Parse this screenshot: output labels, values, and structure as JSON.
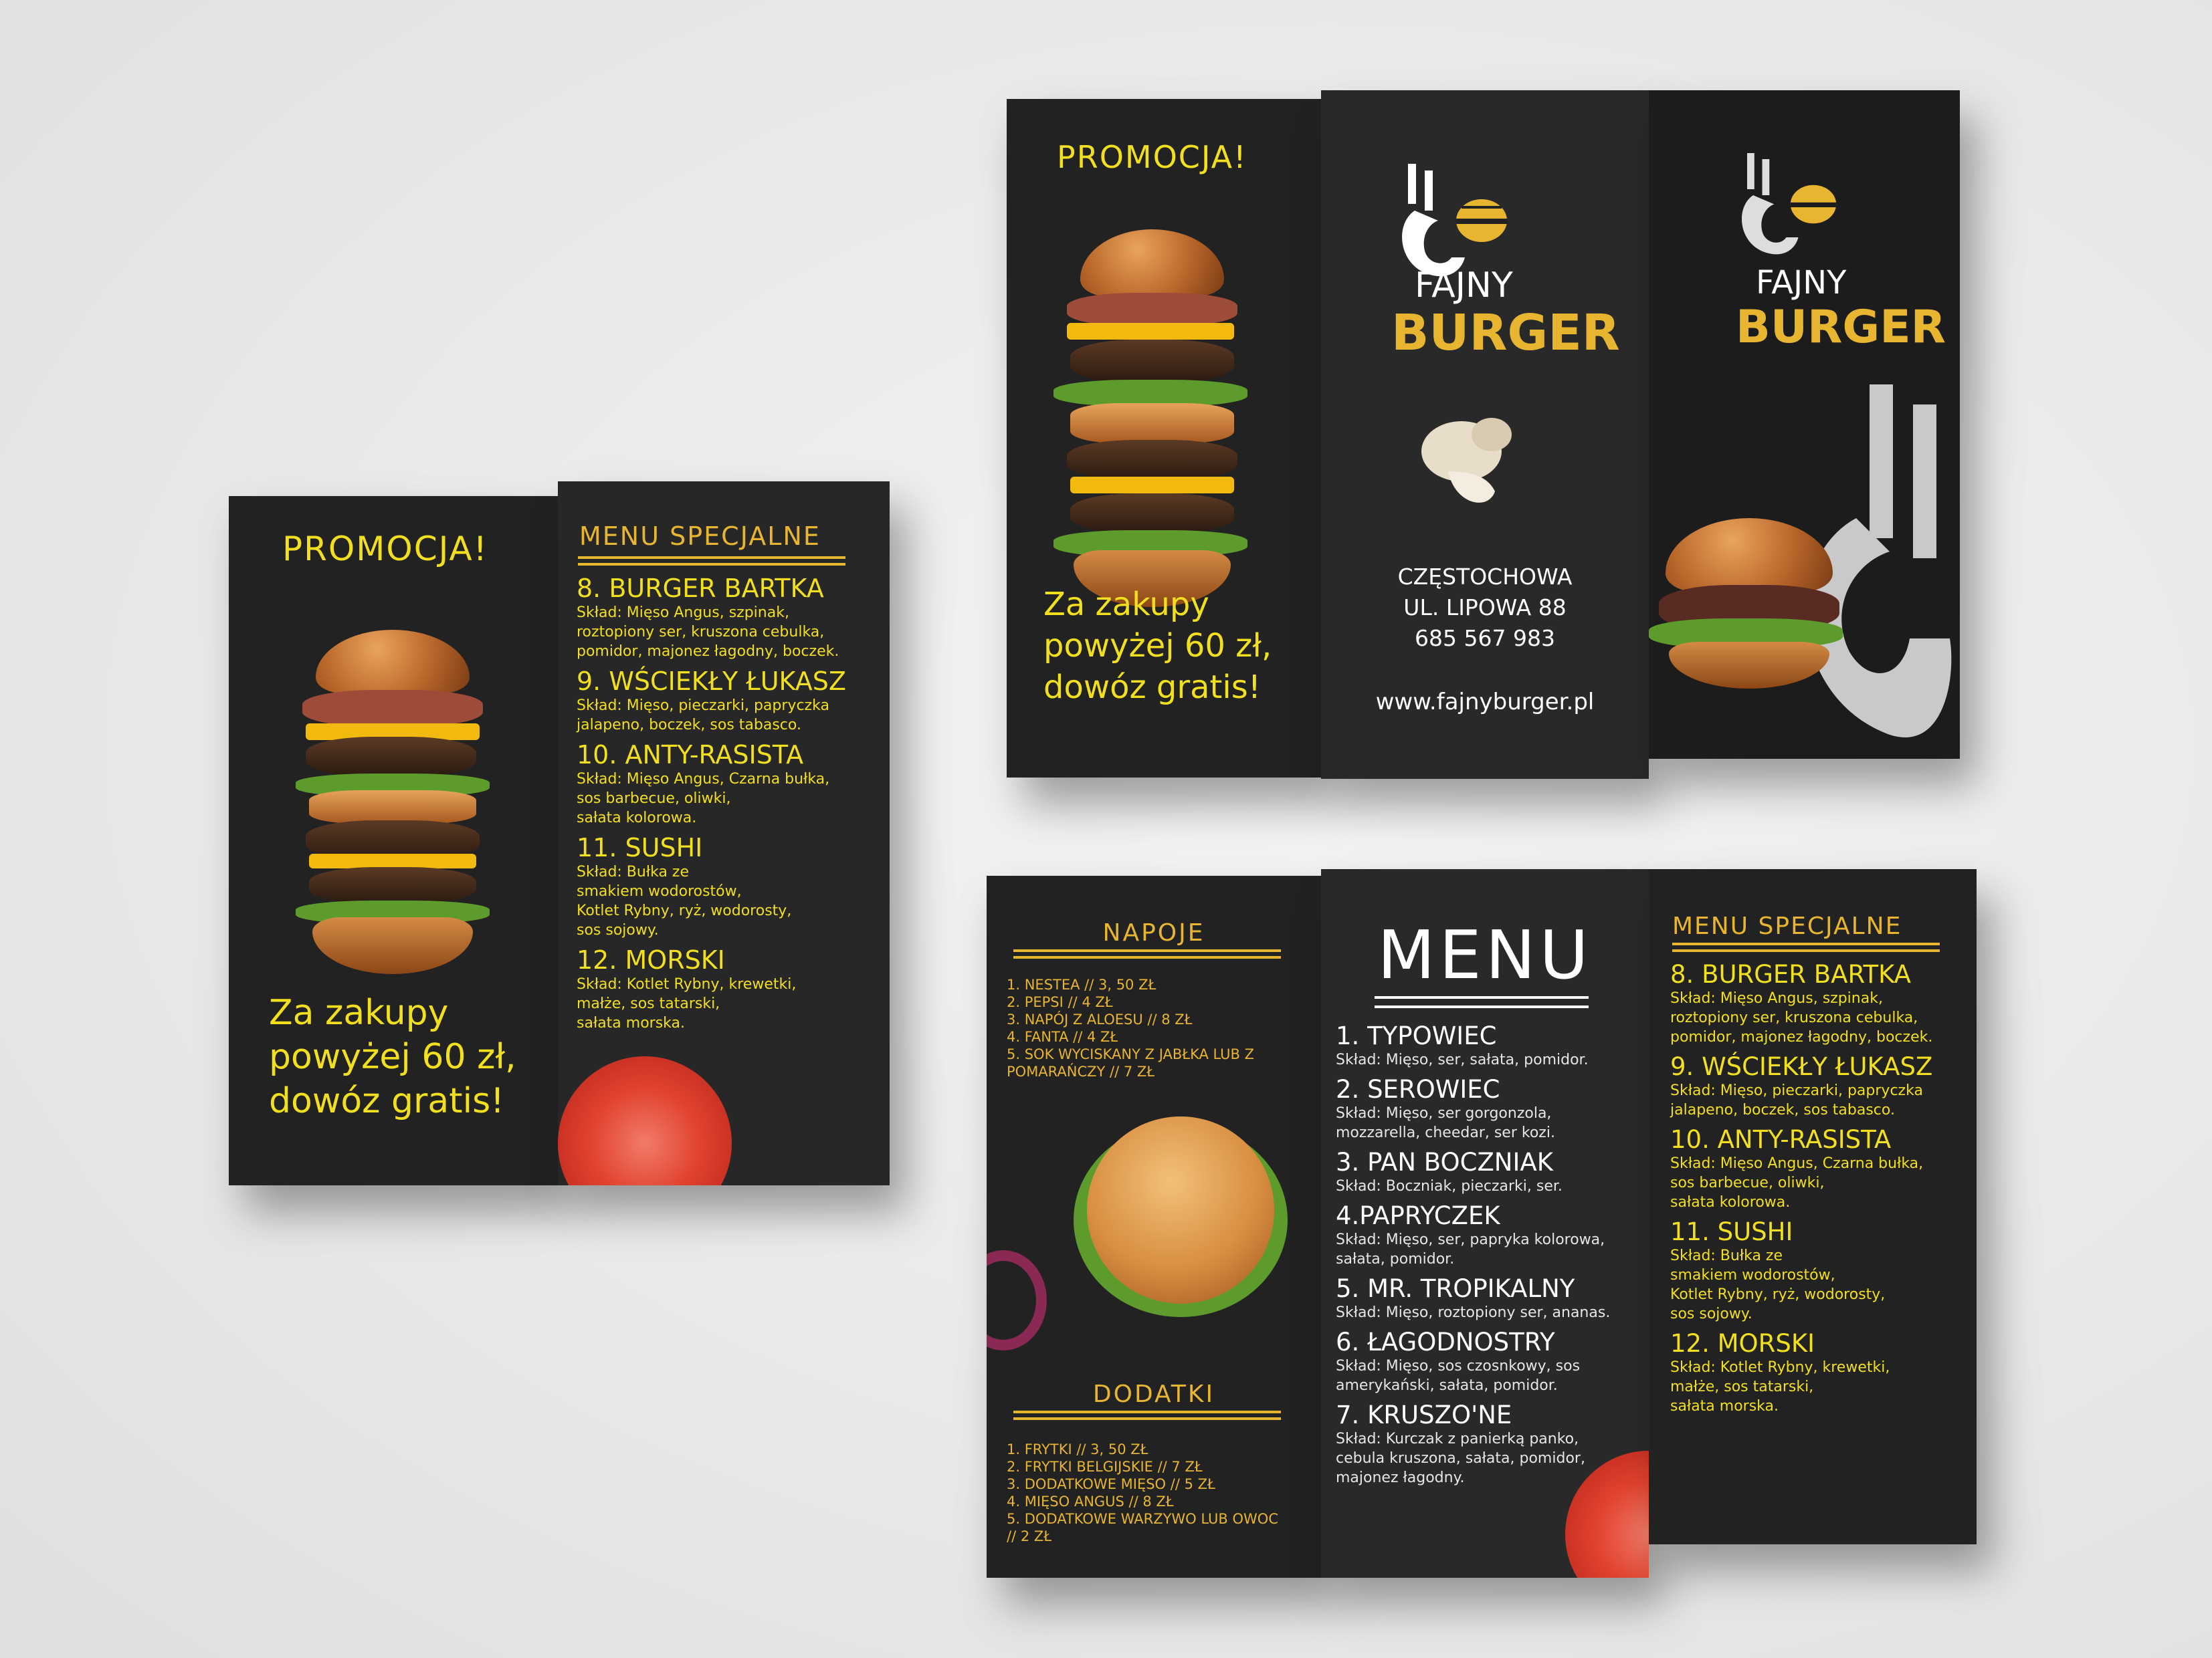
{
  "promo": {
    "heading": "PROMOCJA!",
    "line1": "Za zakupy",
    "line2": "powyżej 60 zł,",
    "line3": "dowóz gratis!"
  },
  "brand": {
    "name_top": "FAJNY",
    "name_bottom": "BURGER",
    "city": "CZĘSTOCHOWA",
    "street": "UL. LIPOWA 88",
    "phone": "685 567 983",
    "website": "www.fajnyburger.pl"
  },
  "special": {
    "heading": "MENU SPECJALNE",
    "items": [
      {
        "title": "8. BURGER BARTKA",
        "desc": [
          "Skład: Mięso Angus, szpinak,",
          "roztopiony ser, kruszona cebulka,",
          "pomidor, majonez łagodny, boczek."
        ]
      },
      {
        "title": "9. WŚCIEKŁY ŁUKASZ",
        "desc": [
          "Skład: Mięso, pieczarki, papryczka",
          "jalapeno, boczek, sos tabasco."
        ]
      },
      {
        "title": "10. ANTY-RASISTA",
        "desc": [
          "Skład: Mięso Angus, Czarna bułka,",
          "sos barbecue, oliwki,",
          "sałata kolorowa."
        ]
      },
      {
        "title": "11. SUSHI",
        "desc": [
          "Skład: Bułka ze",
          "smakiem wodorostów,",
          "Kotlet Rybny, ryż, wodorosty,",
          "sos sojowy."
        ]
      },
      {
        "title": "12. MORSKI",
        "desc": [
          "Skład: Kotlet Rybny, krewetki,",
          "małże, sos tatarski,",
          "sałata morska."
        ]
      }
    ]
  },
  "menu": {
    "heading": "MENU",
    "items": [
      {
        "title": "1. TYPOWIEC",
        "desc": [
          "Skład: Mięso, ser, sałata, pomidor."
        ]
      },
      {
        "title": "2. SEROWIEC",
        "desc": [
          "Skład: Mięso, ser gorgonzola,",
          "mozzarella, cheedar, ser kozi."
        ]
      },
      {
        "title": "3. PAN BOCZNIAK",
        "desc": [
          "Skład: Boczniak, pieczarki, ser."
        ]
      },
      {
        "title": "4.PAPRYCZEK",
        "desc": [
          "Skład: Mięso, ser, papryka kolorowa,",
          "sałata, pomidor."
        ]
      },
      {
        "title": "5. MR. TROPIKALNY",
        "desc": [
          "Skład: Mięso, roztopiony ser, ananas."
        ]
      },
      {
        "title": "6. ŁAGODNOSTRY",
        "desc": [
          "Skład: Mięso, sos czosnkowy, sos",
          "amerykański, sałata, pomidor."
        ]
      },
      {
        "title": "7. KRUSZO'NE",
        "desc": [
          "Skład: Kurczak z panierką panko,",
          "cebula kruszona, sałata, pomidor,",
          "majonez łagodny."
        ]
      }
    ]
  },
  "drinks": {
    "heading": "NAPOJE",
    "items": [
      "1. NESTEA // 3, 50 ZŁ",
      "2. PEPSI  // 4 ZŁ",
      "3. NAPÓJ Z ALOESU // 8 ZŁ",
      "4. FANTA // 4 ZŁ",
      "5. SOK WYCISKANY Z JABŁKA LUB Z",
      "POMARAŃCZY // 7 ZŁ"
    ]
  },
  "extras": {
    "heading": "DODATKI",
    "items": [
      "1. FRYTKI // 3, 50 ZŁ",
      "2. FRYTKI BELGIJSKIE // 7 ZŁ",
      "3. DODATKOWE MIĘSO // 5 ZŁ",
      "4. MIĘSO ANGUS // 8 ZŁ",
      "5. DODATKOWE WARZYWO LUB OWOC",
      "// 2 ZŁ"
    ]
  },
  "colors": {
    "panel": "#232222",
    "gold": "#e8b531",
    "yellow": "#f2df1e",
    "background": "#e9e9ea"
  }
}
